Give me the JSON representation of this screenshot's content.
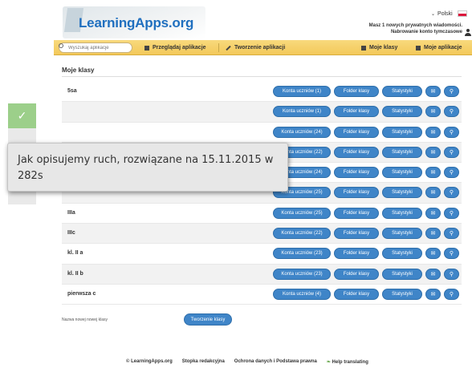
{
  "header": {
    "logo": "LearningApps.org",
    "language": "Polski",
    "unread_messages": "Masz 1 nowych prywatnych wiadomości.",
    "forgot_password": "Nabrowanie konto tymczasowe"
  },
  "nav": {
    "search_placeholder": "Wyszukaj aplikacje",
    "browse": "Przeglądaj aplikacje",
    "create": "Tworzenie aplikacji",
    "my_classes": "Moje klasy",
    "my_apps": "Moje aplikacje"
  },
  "page": {
    "title": "Moje klasy",
    "new_class_label": "Nazwa nowej nowej klasy",
    "new_class_button": "Tworzenie klasy"
  },
  "row_buttons": {
    "folder": "Folder klasy",
    "stats": "Statystyki",
    "mail_icon": "envelope-icon",
    "search_icon": "magnifier-icon"
  },
  "classes": [
    {
      "name": "5sa",
      "accounts": "Konta uczniów (1)"
    },
    {
      "name": "",
      "accounts": "Konta uczniów (1)"
    },
    {
      "name": "",
      "accounts": "Konta uczniów (24)"
    },
    {
      "name": "",
      "accounts": "Konta uczniów (22)"
    },
    {
      "name": "",
      "accounts": "Konta uczniów (24)"
    },
    {
      "name": "",
      "accounts": "Konta uczniów (25)"
    },
    {
      "name": "IIIa",
      "accounts": "Konta uczniów (25)"
    },
    {
      "name": "IIIc",
      "accounts": "Konta uczniów (22)"
    },
    {
      "name": "kl. II a",
      "accounts": "Konta uczniów (23)"
    },
    {
      "name": "kl. II b",
      "accounts": "Konta uczniów (23)"
    },
    {
      "name": "pierwsza c",
      "accounts": "Konta uczniów (4)"
    }
  ],
  "footer": {
    "copyright": "© LearningApps.org",
    "imprint": "Stopka redakcyjna",
    "privacy": "Ochrona danych i Podstawa prawna",
    "translate": "Help translating"
  },
  "overlay": {
    "check": "✓",
    "message": "Jak opisujemy ruch, rozwiązane na 15.11.2015 w 282s"
  }
}
